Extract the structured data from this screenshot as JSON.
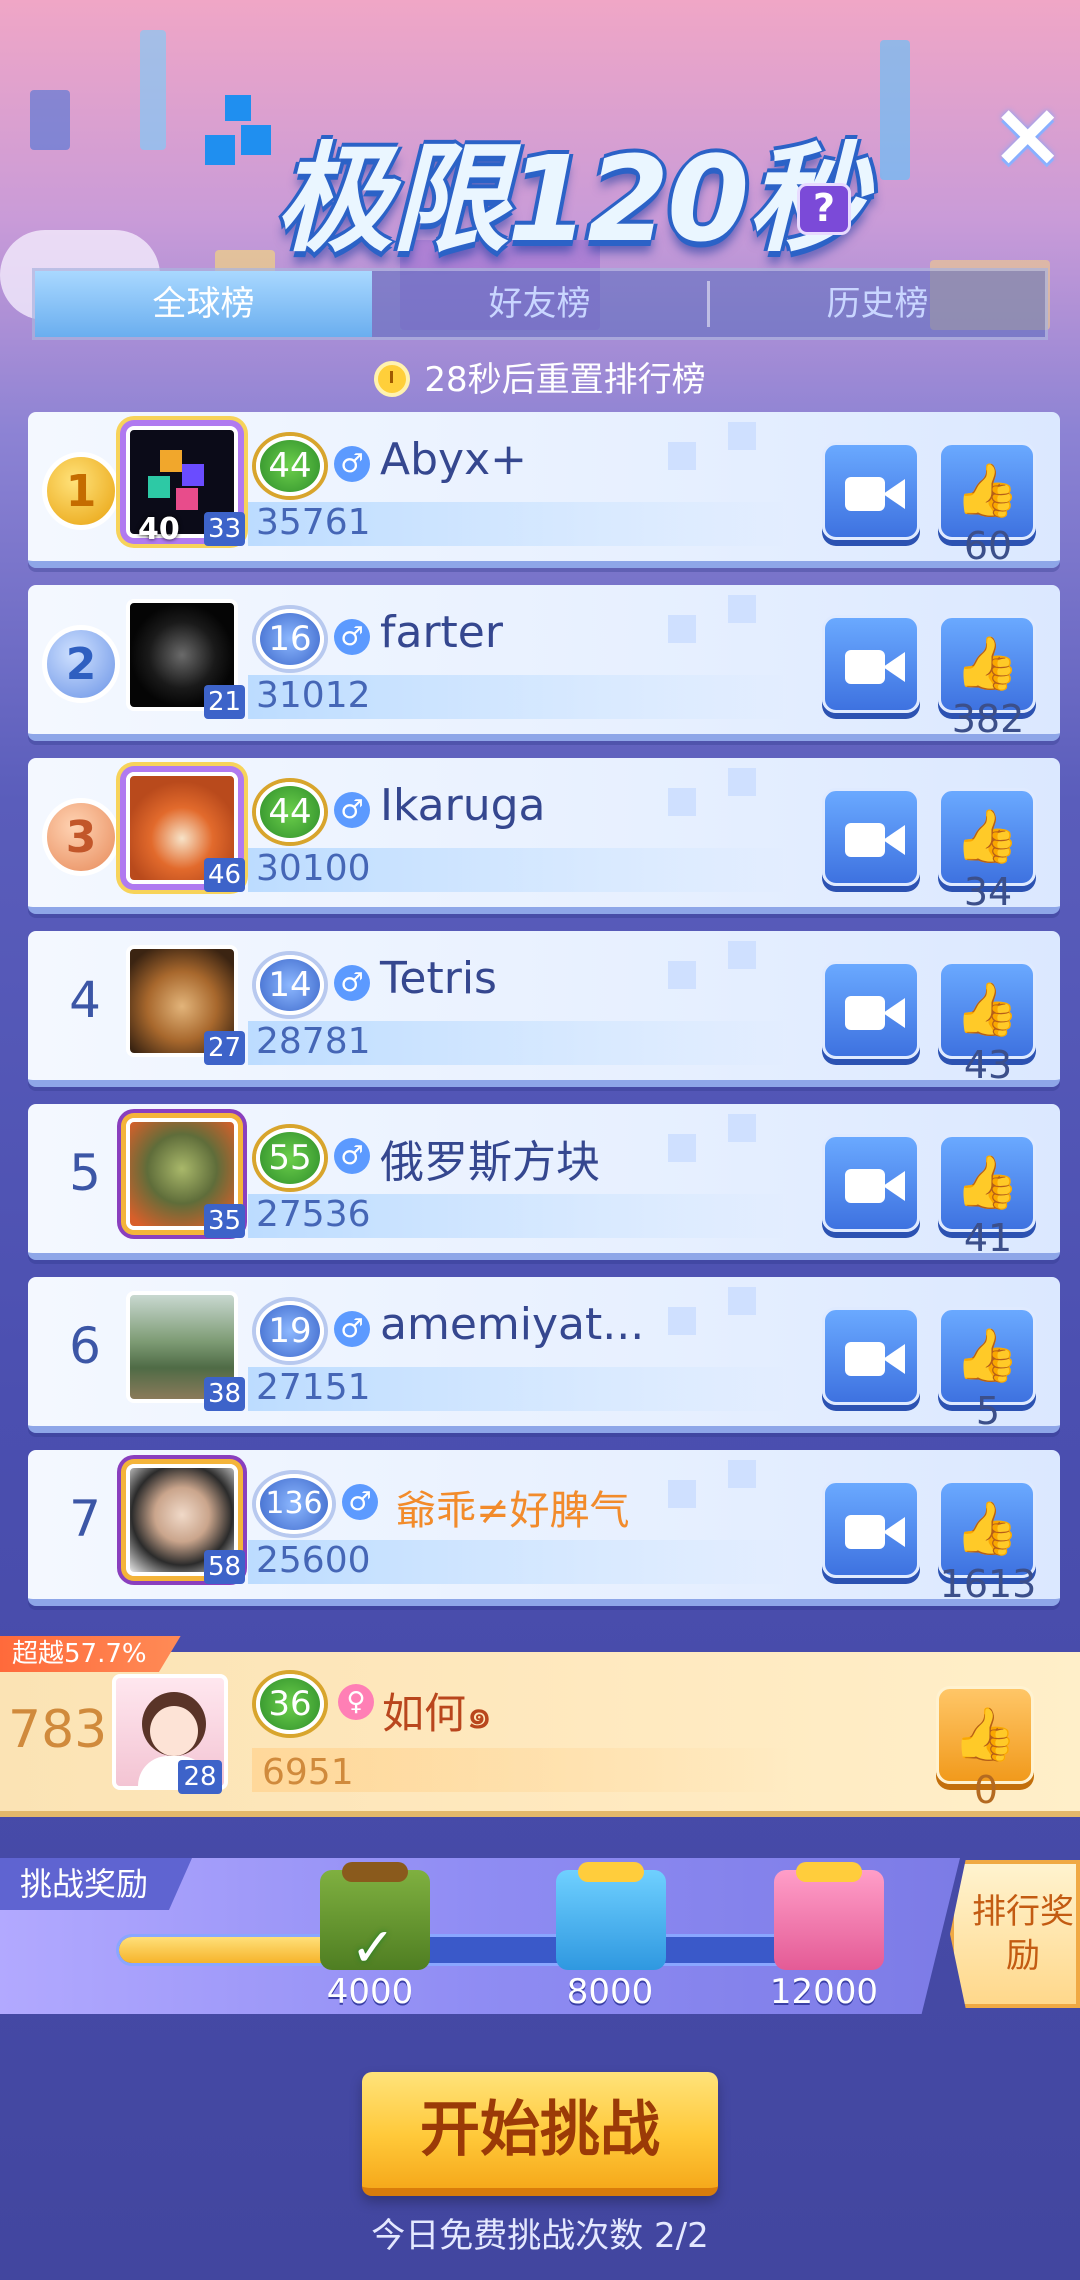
{
  "header": {
    "title": "极限120秒",
    "help_icon": "?",
    "close_icon": "×"
  },
  "tabs": [
    {
      "label": "全球榜",
      "active": true
    },
    {
      "label": "好友榜",
      "active": false
    },
    {
      "label": "历史榜",
      "active": false
    }
  ],
  "reset_text": "28秒后重置排行榜",
  "rows": [
    {
      "rank": "1",
      "name": "Abyx+",
      "level": "44",
      "avatar_level": "33",
      "avatar_badge": "40",
      "score": "35761",
      "likes": "60"
    },
    {
      "rank": "2",
      "name": "farter",
      "level": "16",
      "avatar_level": "21",
      "score": "31012",
      "likes": "382"
    },
    {
      "rank": "3",
      "name": "Ikaruga",
      "level": "44",
      "avatar_level": "46",
      "score": "30100",
      "likes": "34"
    },
    {
      "rank": "4",
      "name": "Tetris",
      "level": "14",
      "avatar_level": "27",
      "score": "28781",
      "likes": "43"
    },
    {
      "rank": "5",
      "name": "俄罗斯方块",
      "level": "55",
      "avatar_level": "35",
      "score": "27536",
      "likes": "41"
    },
    {
      "rank": "6",
      "name": "amemiyat...",
      "level": "19",
      "avatar_level": "38",
      "score": "27151",
      "likes": "5"
    },
    {
      "rank": "7",
      "name": "爺乖≠好脾气",
      "level": "136",
      "avatar_level": "58",
      "score": "25600",
      "likes": "1613"
    }
  ],
  "me": {
    "surpass": "超越57.7%",
    "rank": "783",
    "name": "如何๑",
    "level": "36",
    "avatar_level": "28",
    "score": "6951",
    "likes": "0"
  },
  "rewards": {
    "tag": "挑战奖励",
    "progress": 0.4,
    "milestones": [
      "4000",
      "8000",
      "12000"
    ],
    "rank_reward": "排行奖励"
  },
  "start_button": "开始挑战",
  "free_count": "今日免费挑战次数 2/2",
  "colors": {
    "accent": "#3e72e0",
    "gold": "#f6b42b",
    "me_bg": "#ffe9bf"
  }
}
